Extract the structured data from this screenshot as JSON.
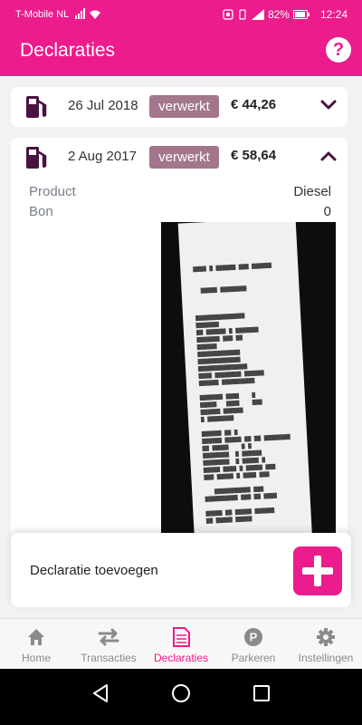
{
  "status": {
    "carrier": "T-Mobile  NL",
    "battery": "82%",
    "time": "12:24"
  },
  "appbar": {
    "title": "Declaraties",
    "help_glyph": "?"
  },
  "declarations": [
    {
      "date": "26 Jul 2018",
      "status": "verwerkt",
      "amount": "€ 44,26",
      "icon": "fuel-pump-icon",
      "expanded": false
    },
    {
      "date": "2 Aug 2017",
      "status": "verwerkt",
      "amount": "€ 58,64",
      "icon": "fuel-pump-icon",
      "expanded": true,
      "details": {
        "product_label": "Product",
        "product_value": "Diesel",
        "bon_label": "Bon",
        "bon_value": "0"
      }
    }
  ],
  "add": {
    "label": "Declaratie toevoegen"
  },
  "nav": [
    {
      "label": "Home",
      "icon": "home-icon",
      "active": false
    },
    {
      "label": "Transacties",
      "icon": "swap-arrows-icon",
      "active": false
    },
    {
      "label": "Declaraties",
      "icon": "document-icon",
      "active": true
    },
    {
      "label": "Parkeren",
      "icon": "parking-icon",
      "active": false
    },
    {
      "label": "Instellingen",
      "icon": "gear-icon",
      "active": false
    }
  ],
  "colors": {
    "accent": "#ec1c8c",
    "badge": "#a3768c",
    "icon_dark": "#4a1243"
  }
}
